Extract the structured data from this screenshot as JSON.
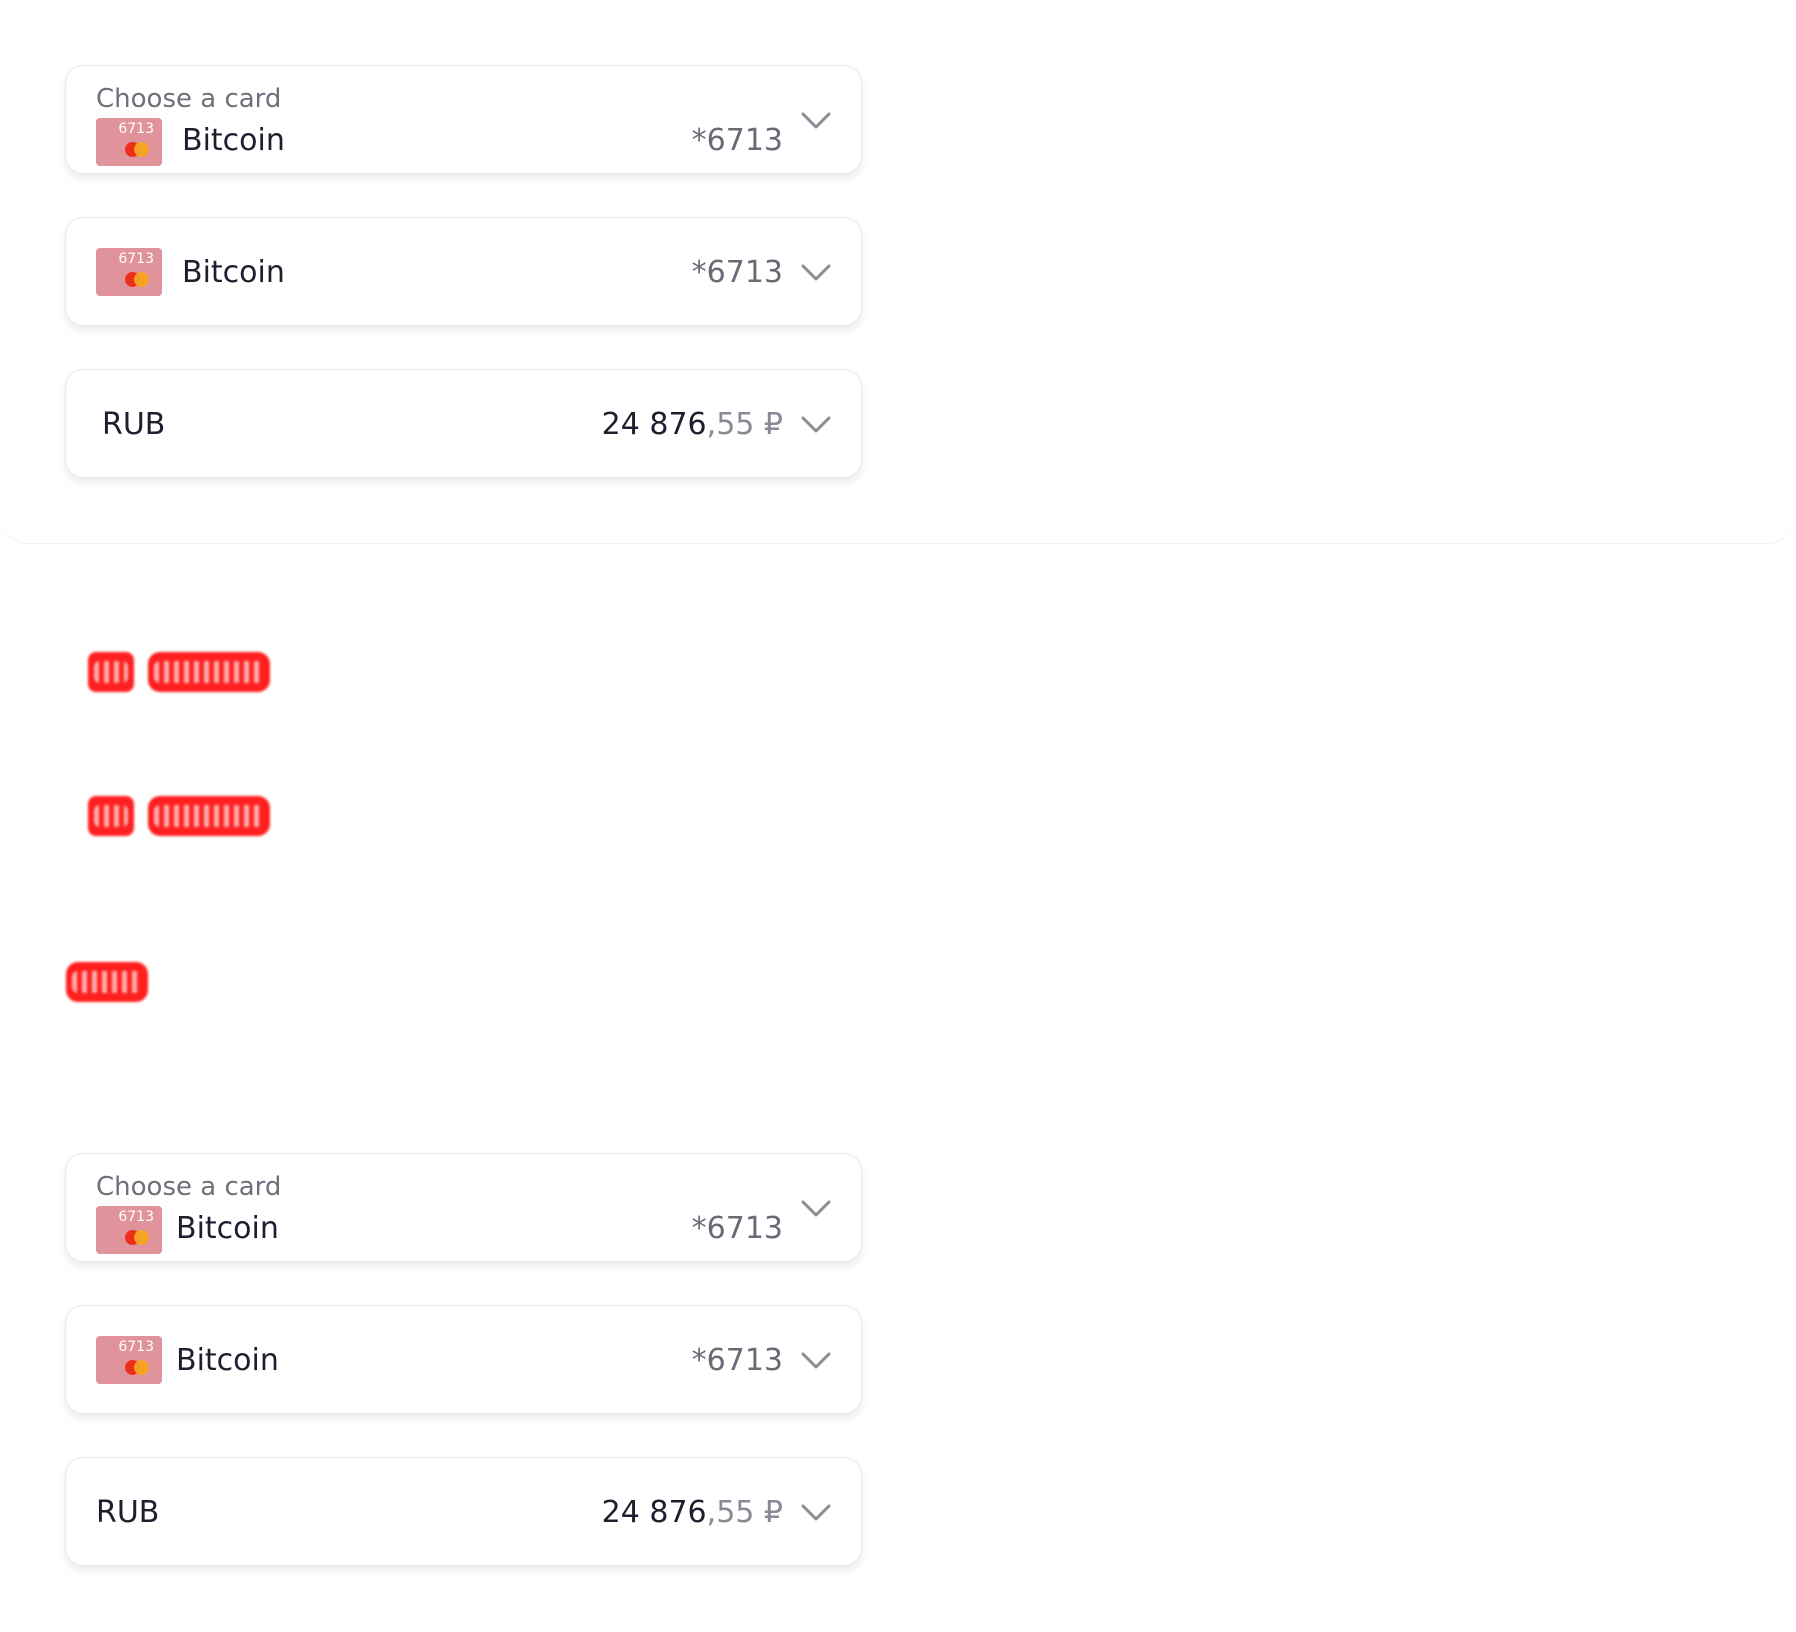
{
  "top_section": {
    "card_select_labeled": {
      "label": "Choose a card",
      "card_thumb_number": "6713",
      "card_name": "Bitcoin",
      "card_last4": "*6713"
    },
    "card_select": {
      "card_thumb_number": "6713",
      "card_name": "Bitcoin",
      "card_last4": "*6713"
    },
    "currency_select": {
      "currency": "RUB",
      "amount_integer": "24 876",
      "amount_fraction": ",55 ₽"
    }
  },
  "bottom_section": {
    "card_select_labeled": {
      "label": "Choose a card",
      "card_thumb_number": "6713",
      "card_name": "Bitcoin",
      "card_last4": "*6713"
    },
    "card_select": {
      "card_thumb_number": "6713",
      "card_name": "Bitcoin",
      "card_last4": "*6713"
    },
    "currency_select": {
      "currency": "RUB",
      "amount_integer": "24 876",
      "amount_fraction": ",55 ₽"
    }
  },
  "icons": {
    "chevron": "chevron-down-icon",
    "card": "card-icon",
    "mastercard": "mastercard-logo-icon"
  },
  "colors": {
    "card_thumb": "#e0939a",
    "mastercard_red": "#eb2d1c",
    "mastercard_orange": "#f7a41f",
    "redaction": "#ff1f1f",
    "text_primary": "#1e1e2e",
    "text_secondary": "#6f6f7c"
  }
}
